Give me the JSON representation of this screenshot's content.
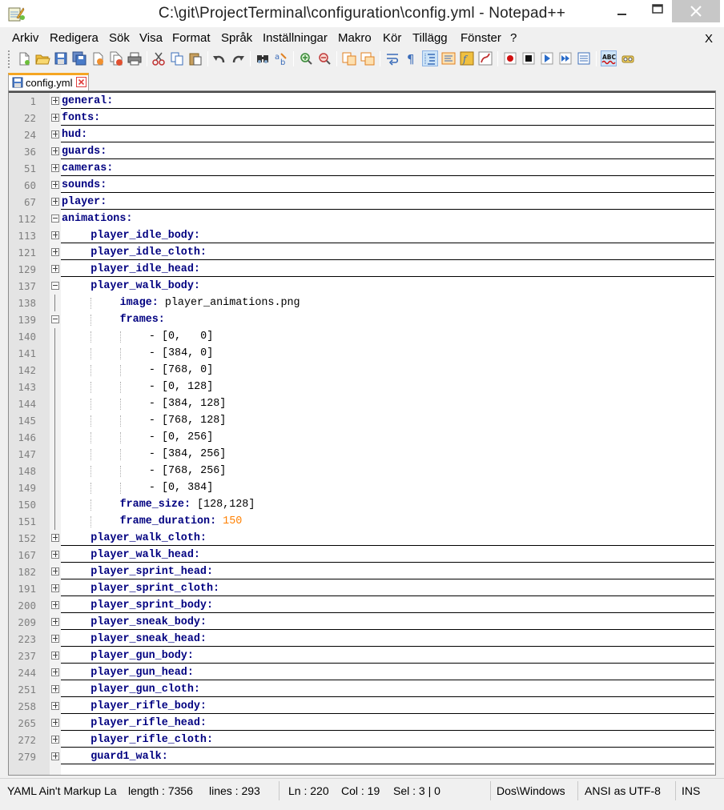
{
  "window": {
    "title": "C:\\git\\ProjectTerminal\\configuration\\config.yml - Notepad++"
  },
  "menu": [
    "Arkiv",
    "Redigera",
    "Sök",
    "Visa",
    "Format",
    "Språk",
    "Inställningar",
    "Makro",
    "Kör",
    "Tillägg",
    "Fönster",
    "?"
  ],
  "menu_close": "X",
  "toolbar": {
    "icons": [
      "new-file-icon",
      "open-file-icon",
      "save-icon",
      "save-all-icon",
      "close-icon",
      "close-all-icon",
      "print-icon",
      "cut-icon",
      "copy-icon",
      "paste-icon",
      "undo-icon",
      "redo-icon",
      "find-icon",
      "replace-icon",
      "zoom-in-icon",
      "zoom-out-icon",
      "sync-vertical-icon",
      "sync-horizontal-icon",
      "word-wrap-icon",
      "show-all-chars-icon",
      "indent-guide-icon",
      "document-map-icon",
      "function-list-icon",
      "folder-as-workspace-icon",
      "record-macro-icon",
      "stop-recording-icon",
      "play-macro-icon",
      "run-macro-multiple-icon",
      "save-macro-icon",
      "spell-check-icon",
      "plugin-icon"
    ]
  },
  "tab": {
    "label": "config.yml"
  },
  "editor": {
    "lines": [
      {
        "n": "1",
        "indent": 0,
        "fold": "plus",
        "key": "general:",
        "underline": true
      },
      {
        "n": "22",
        "indent": 0,
        "fold": "plus",
        "key": "fonts:",
        "underline": true
      },
      {
        "n": "24",
        "indent": 0,
        "fold": "plus",
        "key": "hud:",
        "underline": true
      },
      {
        "n": "36",
        "indent": 0,
        "fold": "plus",
        "key": "guards:",
        "underline": true
      },
      {
        "n": "51",
        "indent": 0,
        "fold": "plus",
        "key": "cameras:",
        "underline": true
      },
      {
        "n": "60",
        "indent": 0,
        "fold": "plus",
        "key": "sounds:",
        "underline": true
      },
      {
        "n": "67",
        "indent": 0,
        "fold": "plus",
        "key": "player:",
        "underline": true
      },
      {
        "n": "112",
        "indent": 0,
        "fold": "minus",
        "key": "animations:",
        "underline": false
      },
      {
        "n": "113",
        "indent": 1,
        "fold": "plus",
        "key": "player_idle_body:",
        "underline": true
      },
      {
        "n": "121",
        "indent": 1,
        "fold": "plus",
        "key": "player_idle_cloth:",
        "underline": true
      },
      {
        "n": "129",
        "indent": 1,
        "fold": "plus",
        "key": "player_idle_head:",
        "underline": true
      },
      {
        "n": "137",
        "indent": 1,
        "fold": "minus",
        "key": "player_walk_body:",
        "underline": false
      },
      {
        "n": "138",
        "indent": 2,
        "fold": "",
        "key": "image:",
        "val": " player_animations.png",
        "underline": false
      },
      {
        "n": "139",
        "indent": 2,
        "fold": "minus",
        "key": "frames:",
        "underline": false
      },
      {
        "n": "140",
        "indent": 3,
        "fold": "",
        "val": "- [0,   0]",
        "underline": false
      },
      {
        "n": "141",
        "indent": 3,
        "fold": "",
        "val": "- [384, 0]",
        "underline": false
      },
      {
        "n": "142",
        "indent": 3,
        "fold": "",
        "val": "- [768, 0]",
        "underline": false
      },
      {
        "n": "143",
        "indent": 3,
        "fold": "",
        "val": "- [0, 128]",
        "underline": false
      },
      {
        "n": "144",
        "indent": 3,
        "fold": "",
        "val": "- [384, 128]",
        "underline": false
      },
      {
        "n": "145",
        "indent": 3,
        "fold": "",
        "val": "- [768, 128]",
        "underline": false
      },
      {
        "n": "146",
        "indent": 3,
        "fold": "",
        "val": "- [0, 256]",
        "underline": false
      },
      {
        "n": "147",
        "indent": 3,
        "fold": "",
        "val": "- [384, 256]",
        "underline": false
      },
      {
        "n": "148",
        "indent": 3,
        "fold": "",
        "val": "- [768, 256]",
        "underline": false
      },
      {
        "n": "149",
        "indent": 3,
        "fold": "",
        "val": "- [0, 384]",
        "underline": false
      },
      {
        "n": "150",
        "indent": 2,
        "fold": "",
        "key": "frame_size:",
        "val": " [128,128]",
        "underline": false
      },
      {
        "n": "151",
        "indent": 2,
        "fold": "",
        "key": "frame_duration:",
        "num": " 150",
        "underline": false
      },
      {
        "n": "152",
        "indent": 1,
        "fold": "plus",
        "key": "player_walk_cloth:",
        "underline": true
      },
      {
        "n": "167",
        "indent": 1,
        "fold": "plus",
        "key": "player_walk_head:",
        "underline": true
      },
      {
        "n": "182",
        "indent": 1,
        "fold": "plus",
        "key": "player_sprint_head:",
        "underline": true
      },
      {
        "n": "191",
        "indent": 1,
        "fold": "plus",
        "key": "player_sprint_cloth:",
        "underline": true
      },
      {
        "n": "200",
        "indent": 1,
        "fold": "plus",
        "key": "player_sprint_body:",
        "underline": true
      },
      {
        "n": "209",
        "indent": 1,
        "fold": "plus",
        "key": "player_sneak_body:",
        "underline": true
      },
      {
        "n": "223",
        "indent": 1,
        "fold": "plus",
        "key": "player_sneak_head:",
        "underline": true
      },
      {
        "n": "237",
        "indent": 1,
        "fold": "plus",
        "key": "player_gun_body:",
        "underline": true
      },
      {
        "n": "244",
        "indent": 1,
        "fold": "plus",
        "key": "player_gun_head:",
        "underline": true
      },
      {
        "n": "251",
        "indent": 1,
        "fold": "plus",
        "key": "player_gun_cloth:",
        "underline": true
      },
      {
        "n": "258",
        "indent": 1,
        "fold": "plus",
        "key": "player_rifle_body:",
        "underline": true
      },
      {
        "n": "265",
        "indent": 1,
        "fold": "plus",
        "key": "player_rifle_head:",
        "underline": true
      },
      {
        "n": "272",
        "indent": 1,
        "fold": "plus",
        "key": "player_rifle_cloth:",
        "underline": true
      },
      {
        "n": "279",
        "indent": 1,
        "fold": "plus",
        "key": "guard1_walk:",
        "underline": true
      }
    ]
  },
  "status": {
    "language": "YAML Ain't Markup La",
    "length": "length : 7356",
    "lines": "lines : 293",
    "ln": "Ln : 220",
    "col": "Col : 19",
    "sel": "Sel : 3 | 0",
    "eol": "Dos\\Windows",
    "encoding": "ANSI as UTF-8",
    "mode": "INS"
  },
  "colors": {
    "keyword": "#000080",
    "number": "#ff8000",
    "tab_accent": "#f5a623",
    "close_red": "#e04040"
  }
}
